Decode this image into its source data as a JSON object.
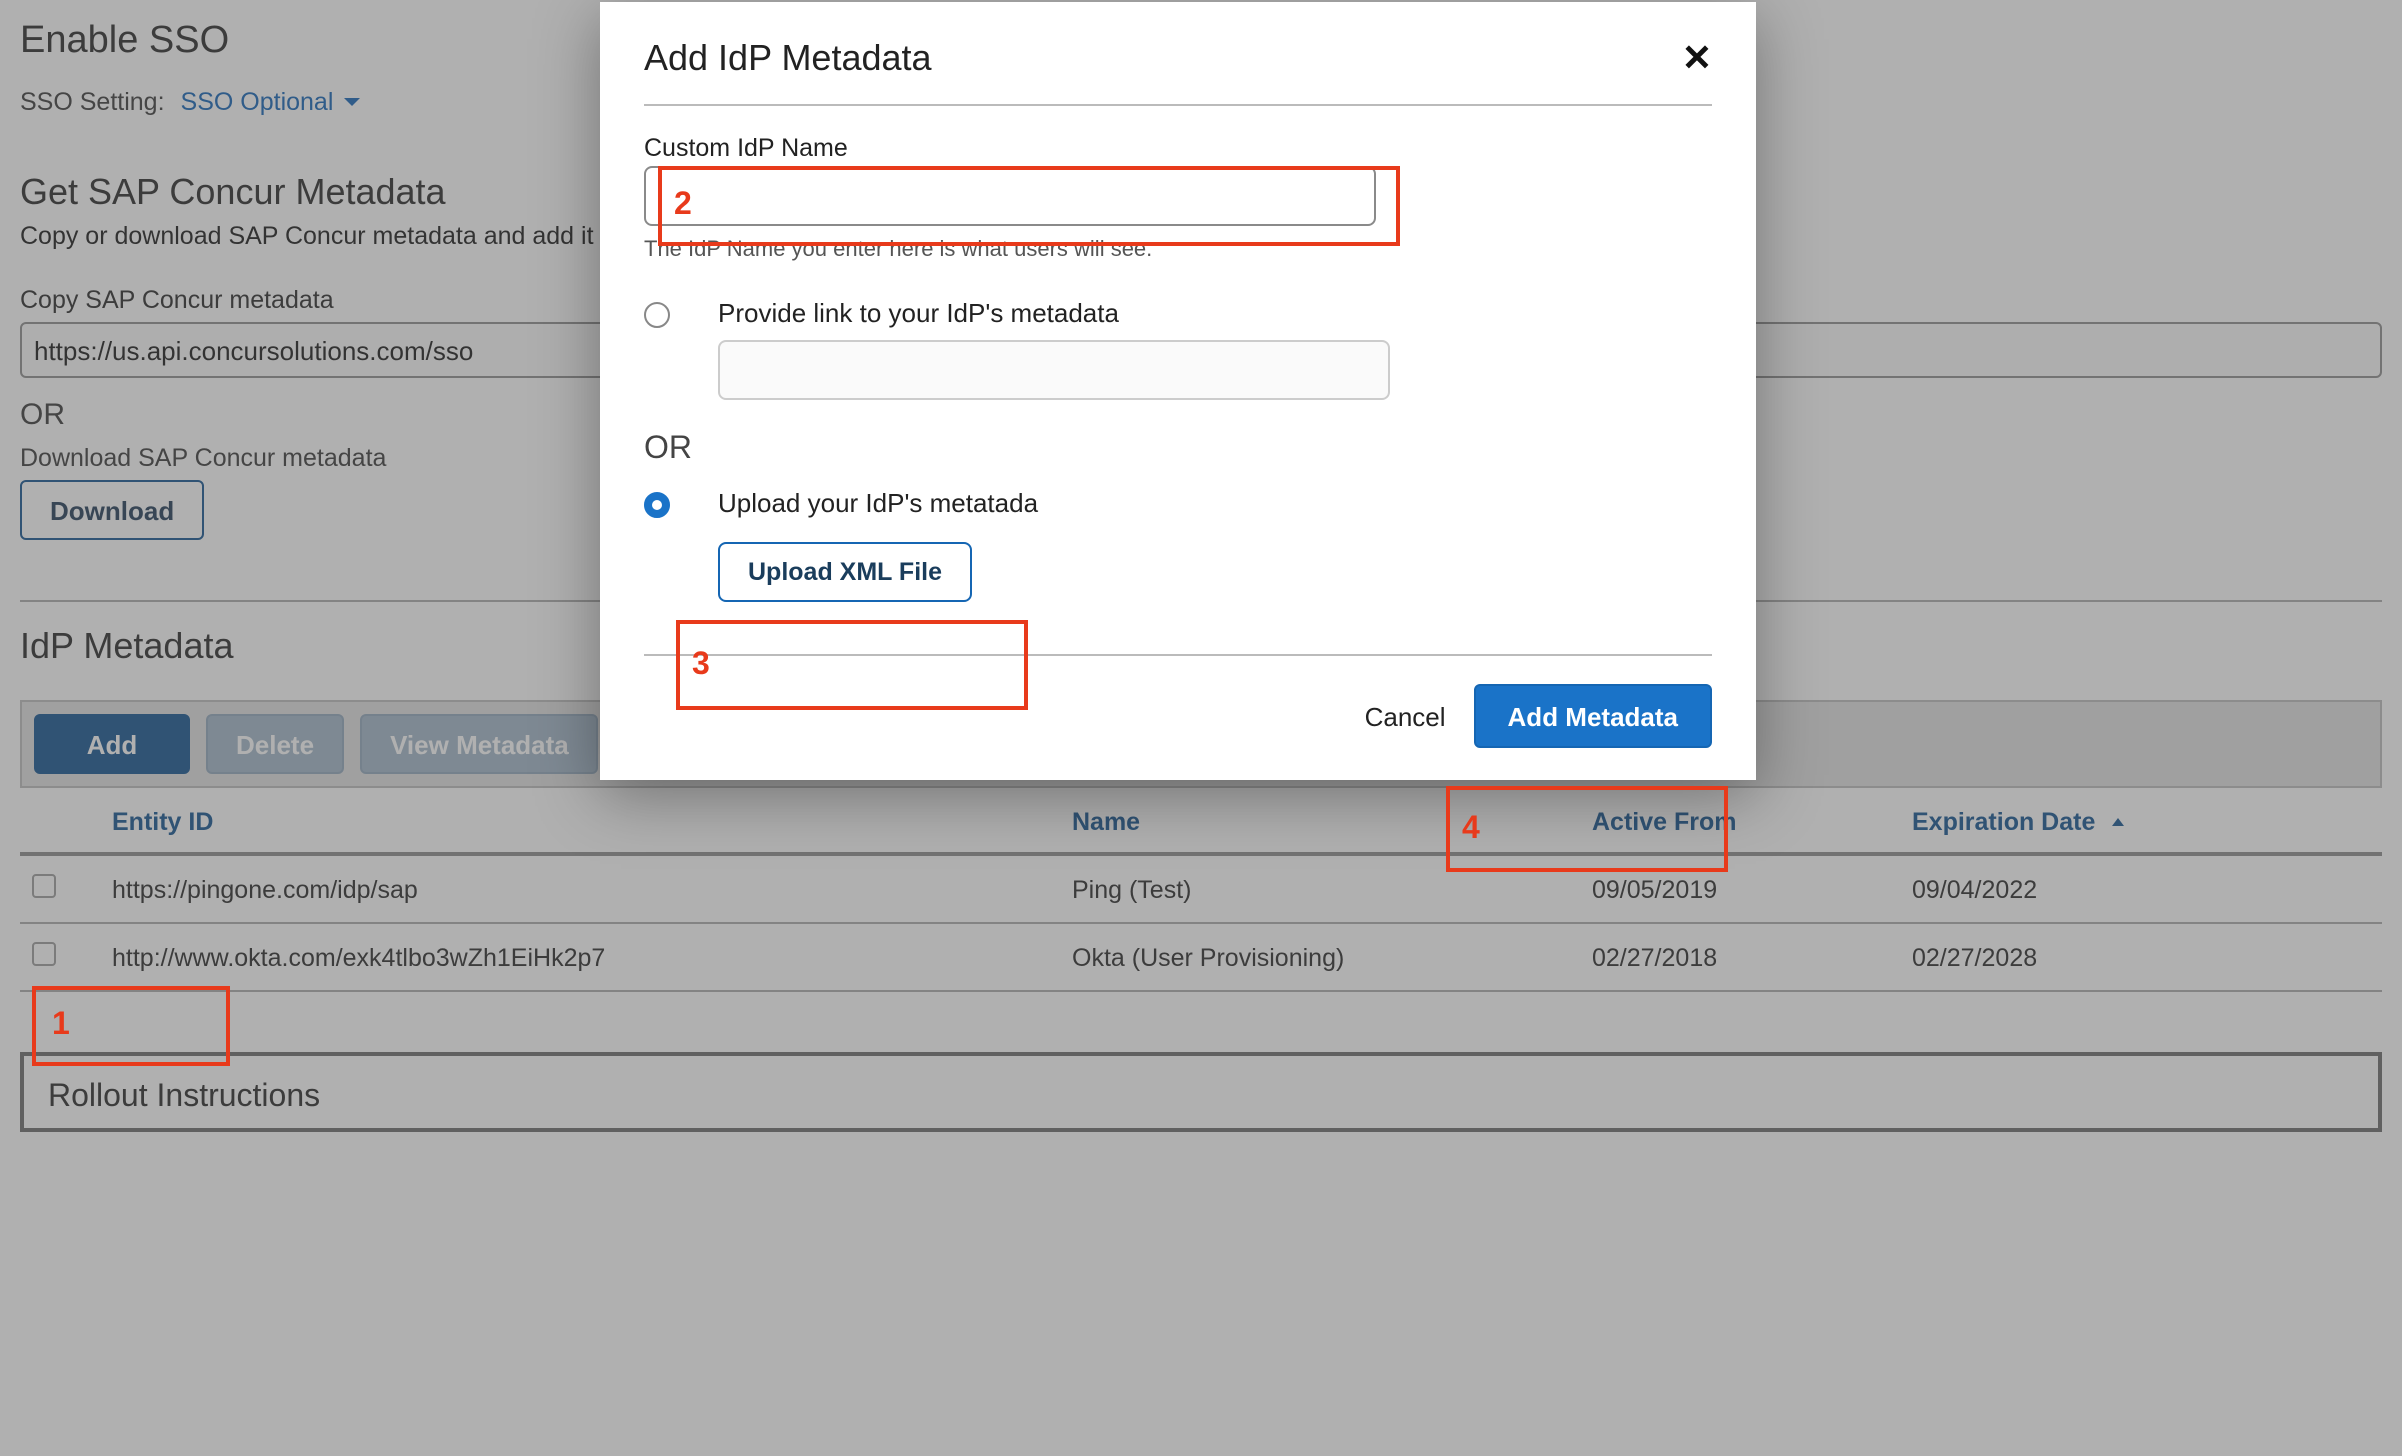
{
  "page": {
    "enable_sso_heading": "Enable SSO",
    "sso_setting_label": "SSO Setting:",
    "sso_setting_value": "SSO Optional",
    "get_metadata_heading": "Get SAP Concur Metadata",
    "get_metadata_subtext": "Copy or download SAP Concur metadata and add it to your IdP.",
    "copy_metadata_label": "Copy SAP Concur metadata",
    "copy_metadata_value": "https://us.api.concursolutions.com/sso",
    "or_label": "OR",
    "download_label": "Download SAP Concur metadata",
    "download_button": "Download",
    "idp_metadata_heading": "IdP Metadata",
    "toolbar": {
      "add": "Add",
      "delete": "Delete",
      "view": "View Metadata"
    },
    "table": {
      "headers": {
        "entity_id": "Entity ID",
        "name": "Name",
        "active_from": "Active From",
        "expiration": "Expiration Date"
      },
      "rows": [
        {
          "entity_id": "https://pingone.com/idp/sap",
          "name": "Ping (Test)",
          "active_from": "09/05/2019",
          "expiration": "09/04/2022"
        },
        {
          "entity_id": "http://www.okta.com/exk4tlbo3wZh1EiHk2p7",
          "name": "Okta (User Provisioning)",
          "active_from": "02/27/2018",
          "expiration": "02/27/2028"
        }
      ]
    },
    "rollout_heading": "Rollout Instructions"
  },
  "modal": {
    "title": "Add IdP Metadata",
    "custom_name_label": "Custom IdP Name",
    "custom_name_value": "",
    "hint": "The IdP Name you enter here is what users will see.",
    "provide_link_label": "Provide link to your IdP's metadata",
    "or_label": "OR",
    "upload_label": "Upload your IdP's metatada",
    "upload_button": "Upload XML File",
    "cancel": "Cancel",
    "submit": "Add Metadata"
  },
  "annotations": {
    "n1": "1",
    "n2": "2",
    "n3": "3",
    "n4": "4"
  }
}
